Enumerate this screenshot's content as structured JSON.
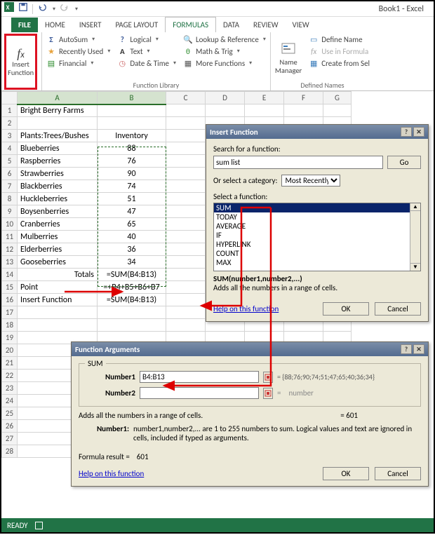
{
  "window": {
    "title": "Book1 - Excel"
  },
  "tabs": {
    "file": "FILE",
    "home": "HOME",
    "insert": "INSERT",
    "pagelayout": "PAGE LAYOUT",
    "formulas": "FORMULAS",
    "data": "DATA",
    "review": "REVIEW",
    "view": "VIEW"
  },
  "ribbon": {
    "insert_function": "Insert\nFunction",
    "autosum": "AutoSum",
    "recent": "Recently Used",
    "financial": "Financial",
    "logical": "Logical",
    "text": "Text",
    "datetime": "Date & Time",
    "lookup": "Lookup & Reference",
    "math": "Math & Trig",
    "more": "More Functions",
    "name_manager": "Name\nManager",
    "def_name": "Define Name",
    "use_formula": "Use in Formula",
    "create_sel": "Create from Sel",
    "group_fnlib": "Function Library",
    "group_defnames": "Defined Names"
  },
  "sheet": {
    "cols": [
      "A",
      "B",
      "C",
      "D",
      "E",
      "F",
      "G"
    ],
    "rows_count": 28,
    "a1": "Bright Berry Farms",
    "a3": "Plants:Trees/Bushes",
    "b3": "Inventory",
    "data": [
      {
        "name": "Blueberries",
        "val": 88
      },
      {
        "name": "Raspberries",
        "val": 76
      },
      {
        "name": "Strawberries",
        "val": 90
      },
      {
        "name": "Blackberries",
        "val": 74
      },
      {
        "name": "Huckleberries",
        "val": 51
      },
      {
        "name": "Boysenberries",
        "val": 47
      },
      {
        "name": "Cranberries",
        "val": 65
      },
      {
        "name": "Mulberries",
        "val": 40
      },
      {
        "name": "Elderberries",
        "val": 36
      },
      {
        "name": "Gooseberries",
        "val": 34
      }
    ],
    "a14": "Totals",
    "b14": "=SUM(B4:B13)",
    "a15": "Point",
    "b15": "=+B4+B5+B6+B7",
    "a16": "Insert Function",
    "b16": "=SUM(B4:B13)"
  },
  "dlg_insert": {
    "title": "Insert Function",
    "search_label": "Search for a function:",
    "search_value": "sum list",
    "go": "Go",
    "cat_label": "Or select a category:",
    "cat_value": "Most Recently Used",
    "select_label": "Select a function:",
    "list": [
      "SUM",
      "TODAY",
      "AVERAGE",
      "IF",
      "HYPERLINK",
      "COUNT",
      "MAX"
    ],
    "syntax": "SUM(number1,number2,...)",
    "desc": "Adds all the numbers in a range of cells.",
    "help": "Help on this function",
    "ok": "OK",
    "cancel": "Cancel"
  },
  "dlg_args": {
    "title": "Function Arguments",
    "fn": "SUM",
    "num1_label": "Number1",
    "num1_value": "B4:B13",
    "num2_label": "Number2",
    "num2_value": "",
    "preview": "= {88;76;90;74;51;47;65;40;36;34}",
    "num2_hint": "number",
    "desc1": "Adds all the numbers in a range of cells.",
    "result_eq": "= 601",
    "arg_help_label": "Number1:",
    "arg_help": "number1,number2,... are 1 to 255 numbers to sum. Logical values and text are ignored in cells, included if typed as arguments.",
    "formula_result_label": "Formula result =",
    "formula_result": "601",
    "help": "Help on this function",
    "ok": "OK",
    "cancel": "Cancel"
  },
  "status": {
    "ready": "READY"
  },
  "colors": {
    "accent": "#217346",
    "highlight": "#d12"
  }
}
